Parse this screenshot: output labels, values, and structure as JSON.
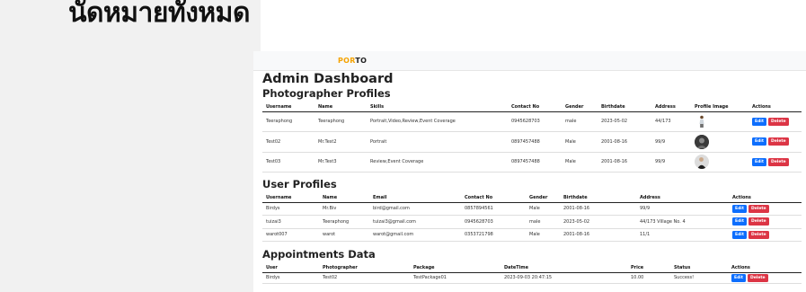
{
  "slide": {
    "title": "นัดหมายทั้งหมด"
  },
  "navbar": {
    "brand_part1": "POR",
    "brand_part2": "TO"
  },
  "page": {
    "title": "Admin Dashboard",
    "photographers_heading": "Photographer Profiles",
    "users_heading": "User Profiles",
    "appointments_heading": "Appointments Data"
  },
  "photographers": {
    "columns": [
      "Username",
      "Name",
      "Skills",
      "Contact No",
      "Gender",
      "Birthdate",
      "Address",
      "Profile Image",
      "Actions"
    ],
    "rows": [
      {
        "username": "Teeraphong",
        "name": "Teeraphong",
        "skills": "Portrait,Video,Review,Event Coverage",
        "contact": "0945628703",
        "gender": "male",
        "birthdate": "2023-05-02",
        "address": "44/173",
        "avatar_icon": "standing-person-icon"
      },
      {
        "username": "Test02",
        "name": "Mr.Test2",
        "skills": "Portrait",
        "contact": "0897457488",
        "gender": "Male",
        "birthdate": "2001-08-16",
        "address": "99/9",
        "avatar_icon": "dark-portrait-icon"
      },
      {
        "username": "Test03",
        "name": "Mr.Test3",
        "skills": "Review,Event Coverage",
        "contact": "0897457488",
        "gender": "Male",
        "birthdate": "2001-08-16",
        "address": "99/9",
        "avatar_icon": "person-in-black-icon"
      }
    ]
  },
  "users": {
    "columns": [
      "Username",
      "Name",
      "Email",
      "Contact No",
      "Gender",
      "Birthdate",
      "Address",
      "Actions"
    ],
    "rows": [
      {
        "username": "Birdys",
        "name": "Mr.Biv",
        "email": "bird@gmail.com",
        "contact": "0857894561",
        "gender": "Male",
        "birthdate": "2001-08-16",
        "address": "99/9"
      },
      {
        "username": "tuizai3",
        "name": "Teeraphong",
        "email": "tuizai3@gmail.com",
        "contact": "0945628703",
        "gender": "male",
        "birthdate": "2023-05-02",
        "address": "44/173 Village No. 4"
      },
      {
        "username": "warot007",
        "name": "warot",
        "email": "warot@gmail.com",
        "contact": "0353721798",
        "gender": "Male",
        "birthdate": "2001-08-16",
        "address": "11/1"
      }
    ]
  },
  "appointments": {
    "columns": [
      "User",
      "Photographer",
      "Package",
      "DateTime",
      "Price",
      "Status",
      "Actions"
    ],
    "rows": [
      {
        "user": "Birdys",
        "photographer": "Test02",
        "package": "TestPackage01",
        "datetime": "2023-09-03 20:47:15",
        "price": "10.00",
        "status": "Success!"
      }
    ]
  },
  "actions": {
    "edit_label": "Edit",
    "delete_label": "Delete"
  },
  "colors": {
    "edit": "#0d6efd",
    "delete": "#dc3545",
    "brand_accent": "#f5a300"
  }
}
